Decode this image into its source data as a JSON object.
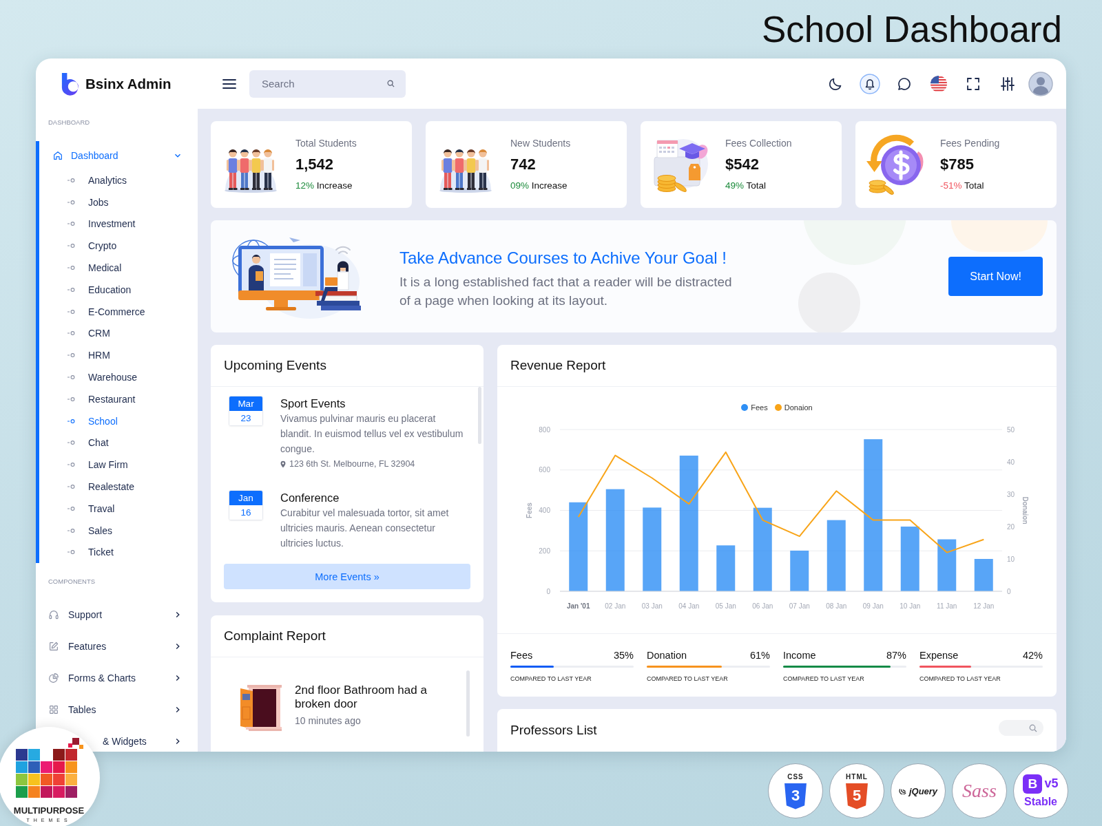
{
  "title": "School Dashboard",
  "window": {
    "brand": "Bsinx Admin",
    "search": {
      "placeholder": "Search"
    },
    "sidebar": [
      {
        "heading": "DASHBOARD",
        "items": [
          {
            "label": "Dashboard",
            "kind": "home",
            "selected": true,
            "expanded": true,
            "children": [
              {
                "label": "Analytics",
                "selected": false
              },
              {
                "label": "Jobs",
                "selected": false
              },
              {
                "label": "Investment",
                "selected": false
              },
              {
                "label": "Crypto",
                "selected": false
              },
              {
                "label": "Medical",
                "selected": false
              },
              {
                "label": "Education",
                "selected": false
              },
              {
                "label": "E-Commerce",
                "selected": false
              },
              {
                "label": "CRM",
                "selected": false
              },
              {
                "label": "HRM",
                "selected": false
              },
              {
                "label": "Warehouse",
                "selected": false
              },
              {
                "label": "Restaurant",
                "selected": false
              },
              {
                "label": "School",
                "selected": true
              },
              {
                "label": "Chat",
                "selected": false
              },
              {
                "label": "Law Firm",
                "selected": false
              },
              {
                "label": "Realestate",
                "selected": false
              },
              {
                "label": "Traval",
                "selected": false
              },
              {
                "label": "Sales",
                "selected": false
              },
              {
                "label": "Ticket",
                "selected": false
              }
            ]
          }
        ]
      },
      {
        "heading": "COMPONENTS",
        "items": [
          {
            "label": "Support",
            "kind": "headset",
            "selected": false,
            "expanded": false
          },
          {
            "label": "Features",
            "kind": "edit",
            "selected": false,
            "expanded": false
          },
          {
            "label": "Forms & Charts",
            "kind": "pie-chart",
            "selected": false,
            "expanded": false
          },
          {
            "label": "Tables",
            "kind": "grid",
            "selected": false,
            "expanded": false
          },
          {
            "label": "& Widgets",
            "selected": false,
            "expanded": false
          }
        ]
      }
    ],
    "stats": [
      {
        "kind": "students",
        "title": "Total Students",
        "value": "1,542",
        "change": "12%",
        "change_label": "Increase",
        "positive": true
      },
      {
        "kind": "students",
        "title": "New Students",
        "value": "742",
        "change": "09%",
        "change_label": "Increase",
        "positive": true
      },
      {
        "kind": "fees",
        "title": "Fees Collection",
        "value": "$542",
        "change": "49%",
        "change_label": "Total",
        "positive": true
      },
      {
        "kind": "pending",
        "title": "Fees Pending",
        "value": "$785",
        "change": "-51%",
        "change_label": "Total",
        "positive": false
      }
    ],
    "banner": {
      "title": "Take Advance Courses to Achive Your Goal !",
      "text": "It is a long established fact that a reader will be distracted of a page when looking at its layout.",
      "button": "Start Now!"
    },
    "events": {
      "title": "Upcoming Events",
      "items": [
        {
          "month": "Mar",
          "day": "23",
          "title": "Sport Events",
          "text": "Vivamus pulvinar mauris eu placerat blandit. In euismod tellus vel ex vestibulum congue.",
          "location": "123 6th St. Melbourne, FL 32904"
        },
        {
          "month": "Jan",
          "day": "16",
          "title": "Conference",
          "text": "Curabitur vel malesuada tortor, sit amet ultricies mauris. Aenean consectetur ultricies luctus."
        }
      ],
      "button": "More Events »"
    },
    "complaints": {
      "title": "Complaint Report",
      "items": [
        {
          "text": "2nd floor Bathroom had a broken door",
          "time": "10 minutes ago"
        }
      ]
    },
    "revenue": {
      "title": "Revenue Report",
      "chart_data": {
        "type": "bar",
        "categories": [
          "Jan '01",
          "02 Jan",
          "03 Jan",
          "04 Jan",
          "05 Jan",
          "06 Jan",
          "07 Jan",
          "08 Jan",
          "09 Jan",
          "10 Jan",
          "11 Jan",
          "12 Jan"
        ],
        "series": [
          {
            "name": "Fees",
            "color": "#2e8ff5",
            "values": [
              440,
              505,
              414,
              671,
              227,
              413,
              201,
              352,
              752,
              320,
              257,
              160
            ]
          },
          {
            "name": "Donaion",
            "type": "line",
            "axis": "y2",
            "color": "#f8a418",
            "values": [
              23,
              42,
              35,
              27,
              43,
              22,
              17,
              31,
              22,
              22,
              12,
              16
            ]
          }
        ],
        "ylabel": "Fees",
        "ylim": [
          0,
          800
        ],
        "yticks": [
          0,
          200,
          400,
          600,
          800
        ],
        "y2label": "Donaion",
        "y2lim": [
          0,
          50
        ],
        "y2ticks": [
          0,
          10,
          20,
          30,
          40,
          50
        ],
        "grid": true,
        "legend": "top"
      },
      "stats": [
        {
          "label": "Fees",
          "percent": "35%",
          "level": 0.35,
          "color": "#0d5cf5",
          "caption": "COMPARED TO LAST YEAR"
        },
        {
          "label": "Donation",
          "percent": "61%",
          "level": 0.61,
          "color": "#f7931e",
          "caption": "COMPARED TO LAST YEAR"
        },
        {
          "label": "Income",
          "percent": "87%",
          "level": 0.87,
          "color": "#138a47",
          "caption": "COMPARED TO LAST YEAR"
        },
        {
          "label": "Expense",
          "percent": "42%",
          "level": 0.42,
          "color": "#f0545e",
          "caption": "COMPARED TO LAST YEAR"
        }
      ]
    },
    "professors": {
      "title": "Professors List"
    }
  },
  "vendor_badge": {
    "name": "MULTIPURPOSE",
    "tagline": "THEMES"
  },
  "tech_badges": [
    {
      "kind": "css",
      "label": "CSS",
      "mark": "3"
    },
    {
      "kind": "html",
      "label": "HTML",
      "mark": "5"
    },
    {
      "kind": "jquery",
      "label": "jQuery"
    },
    {
      "kind": "sass",
      "label": "Sass"
    },
    {
      "kind": "bootstrap",
      "mark": "B",
      "label": "v5",
      "caption": "Stable"
    }
  ]
}
